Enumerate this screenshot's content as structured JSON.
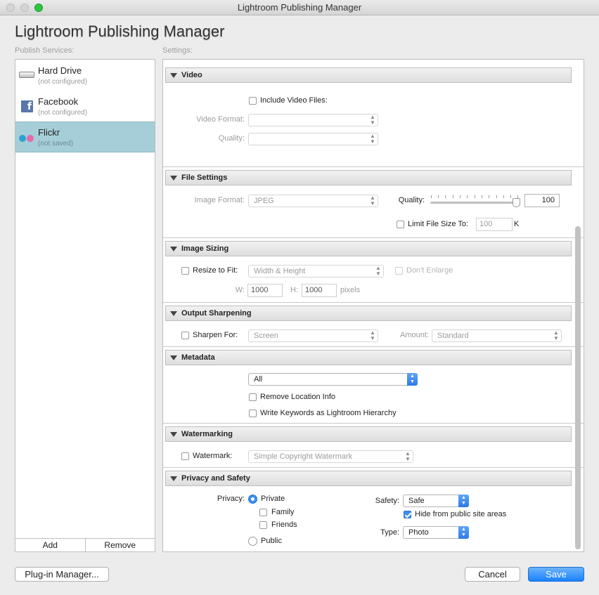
{
  "window": {
    "title": "Lightroom Publishing Manager"
  },
  "header": {
    "title": "Lightroom Publishing Manager",
    "publish_caption": "Publish Services:",
    "settings_caption": "Settings:"
  },
  "services": [
    {
      "name": "Hard Drive",
      "status": "(not configured)",
      "icon": "hard-drive-icon"
    },
    {
      "name": "Facebook",
      "status": "(not configured)",
      "icon": "facebook-icon"
    },
    {
      "name": "Flickr",
      "status": "(not saved)",
      "icon": "flickr-icon",
      "selected": true
    }
  ],
  "service_buttons": {
    "add": "Add",
    "remove": "Remove"
  },
  "video": {
    "title": "Video",
    "include_label": "Include Video Files:",
    "format_label": "Video Format:",
    "quality_label": "Quality:",
    "format_value": "",
    "quality_value": ""
  },
  "file_settings": {
    "title": "File Settings",
    "format_label": "Image Format:",
    "format_value": "JPEG",
    "quality_label": "Quality:",
    "quality_value": "100",
    "limit_label": "Limit File Size To:",
    "limit_value": "100",
    "limit_unit": "K"
  },
  "image_sizing": {
    "title": "Image Sizing",
    "resize_label": "Resize to Fit:",
    "resize_value": "Width & Height",
    "dont_enlarge": "Don't Enlarge",
    "w_label": "W:",
    "w_value": "1000",
    "h_label": "H:",
    "h_value": "1000",
    "unit": "pixels"
  },
  "output_sharpening": {
    "title": "Output Sharpening",
    "sharpen_label": "Sharpen For:",
    "sharpen_value": "Screen",
    "amount_label": "Amount:",
    "amount_value": "Standard"
  },
  "metadata": {
    "title": "Metadata",
    "value": "All",
    "remove_location": "Remove Location Info",
    "write_keywords": "Write Keywords as Lightroom Hierarchy"
  },
  "watermarking": {
    "title": "Watermarking",
    "label": "Watermark:",
    "value": "Simple Copyright Watermark"
  },
  "privacy": {
    "title": "Privacy and Safety",
    "privacy_label": "Privacy:",
    "private": "Private",
    "family": "Family",
    "friends": "Friends",
    "public": "Public",
    "safety_label": "Safety:",
    "safety_value": "Safe",
    "hide_label": "Hide from public site areas",
    "type_label": "Type:",
    "type_value": "Photo"
  },
  "footer": {
    "plugin_manager": "Plug-in Manager...",
    "cancel": "Cancel",
    "save": "Save"
  },
  "colors": {
    "accent": "#3b8ef0",
    "selection": "#a5ced9"
  }
}
